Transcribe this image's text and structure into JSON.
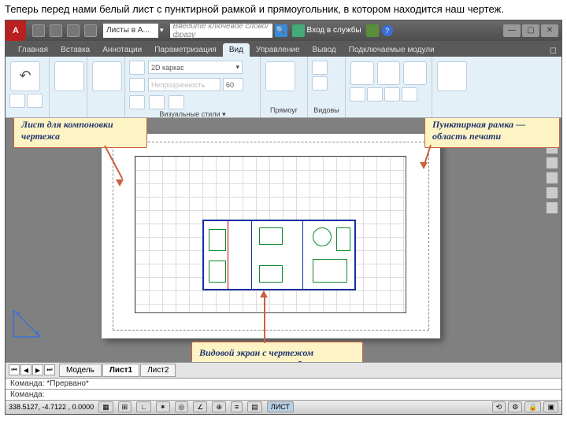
{
  "caption": "Теперь перед нами белый лист с пунктирной рамкой и прямоугольник, в котором находится наш чертеж.",
  "titlebar": {
    "doc_combo": "Листы в А...",
    "search_placeholder": "Введите ключевое слово/фразу",
    "login": "Вход в службы"
  },
  "tabs": {
    "t1": "Главная",
    "t2": "Вставка",
    "t3": "Аннотации",
    "t4": "Параметризация",
    "t5": "Вид",
    "t6": "Управление",
    "t7": "Вывод",
    "t8": "Подключаемые модули"
  },
  "ribbon": {
    "style_combo": "2D каркас",
    "opacity_label": "Непрозрачность",
    "opacity_val": "60",
    "vstyle_combo": "Визуальные стили ▾",
    "rect_lbl": "Прямоуг",
    "vid_lbl": "Видовы"
  },
  "callouts": {
    "c1": "Лист для компоновки чертежа",
    "c2": "Пунктирная рамка — область печати",
    "c3": "Видовой экран с чертежом произвольного масштаба"
  },
  "bottom": {
    "model": "Модель",
    "l1": "Лист1",
    "l2": "Лист2"
  },
  "cmd": {
    "line1": "Команда: *Прервано*",
    "line2": "Команда:"
  },
  "status": {
    "coords": "338.5127, -4.7122 , 0.0000",
    "layout": "ЛИСТ"
  }
}
